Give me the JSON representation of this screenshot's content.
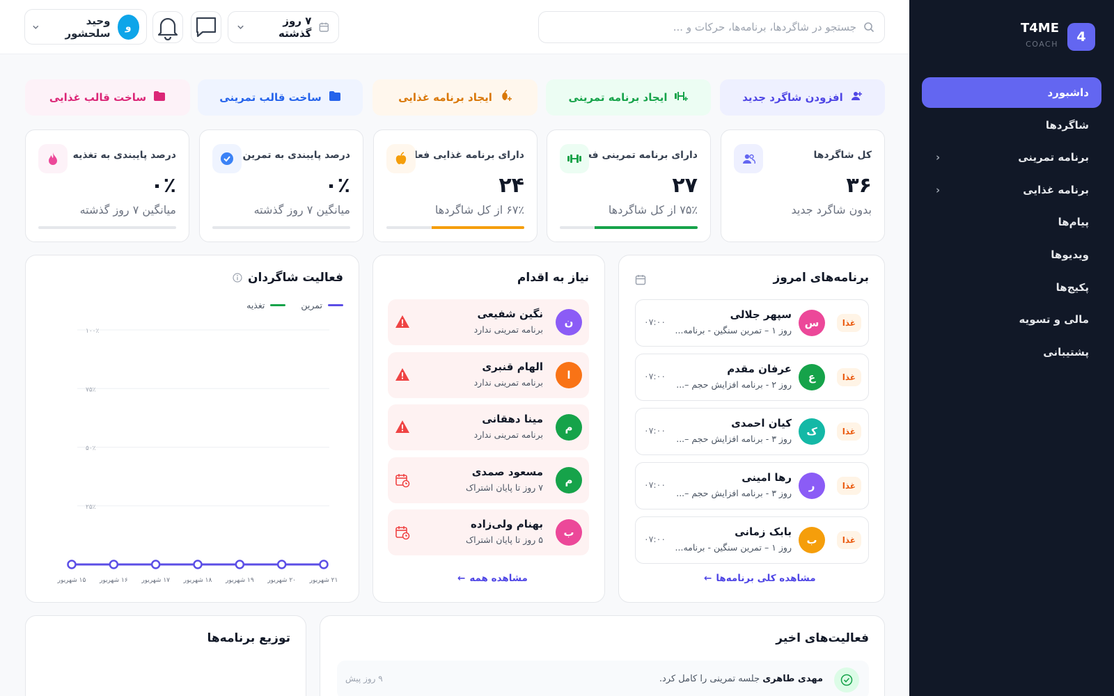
{
  "brand": {
    "badge": "4",
    "title": "T4ME",
    "subtitle": "COACH"
  },
  "nav": [
    {
      "label": "داشبورد",
      "active": true
    },
    {
      "label": "شاگردها"
    },
    {
      "label": "برنامه تمرینی",
      "chevron": true
    },
    {
      "label": "برنامه غذایی",
      "chevron": true
    },
    {
      "label": "پیام‌ها"
    },
    {
      "label": "ویدیوها"
    },
    {
      "label": "پکیج‌ها"
    },
    {
      "label": "مالی و تسویه"
    },
    {
      "label": "پشتیبانی"
    }
  ],
  "header": {
    "search_placeholder": "جستجو در شاگردها، برنامه‌ها، حرکات و ...",
    "date_range": "۷ روز گذشته",
    "user_name": "وحید سلحشور",
    "user_initial": "و"
  },
  "quick_actions": [
    {
      "label": "افزودن شاگرد جدید",
      "bg": "#eef0ff",
      "color": "#4f46e5",
      "icon": "user-plus-icon"
    },
    {
      "label": "ایجاد برنامه تمرینی",
      "bg": "#ecfdf3",
      "color": "#16a34a",
      "icon": "dumbbell-plus-icon"
    },
    {
      "label": "ایجاد برنامه غذایی",
      "bg": "#fff7ed",
      "color": "#d97706",
      "icon": "food-plus-icon"
    },
    {
      "label": "ساخت قالب تمرینی",
      "bg": "#eff4ff",
      "color": "#2563eb",
      "icon": "folder-icon"
    },
    {
      "label": "ساخت قالب غذایی",
      "bg": "#fdf2f8",
      "color": "#db2777",
      "icon": "folder-icon"
    }
  ],
  "stats": [
    {
      "title": "کل شاگردها",
      "value": "۳۶",
      "sub": "بدون شاگرد جدید",
      "icon": "users-icon",
      "icon_bg": "#eef0ff",
      "icon_color": "#6366f1",
      "bar": null
    },
    {
      "title": "دارای برنامه تمرینی فعال",
      "value": "۲۷",
      "sub": "۷۵٪ از کل شاگردها",
      "icon": "dumbbell-icon",
      "icon_bg": "#ecfdf3",
      "icon_color": "#16a34a",
      "bar": 0.75,
      "bar_color": "#16a34a"
    },
    {
      "title": "دارای برنامه غذایی فعال",
      "value": "۲۴",
      "sub": "۶۷٪ از کل شاگردها",
      "icon": "apple-icon",
      "icon_bg": "#fff7ed",
      "icon_color": "#f59e0b",
      "bar": 0.67,
      "bar_color": "#f59e0b"
    },
    {
      "title": "درصد پایبندی به تمرین",
      "value": "۰٪",
      "sub": "میانگین ۷ روز گذشته",
      "icon": "check-circle-icon",
      "icon_bg": "#eff4ff",
      "icon_color": "#3b82f6",
      "bar": 0,
      "bar_color": "#3b82f6"
    },
    {
      "title": "درصد پایبندی به تغذیه",
      "value": "۰٪",
      "sub": "میانگین ۷ روز گذشته",
      "icon": "flame-icon",
      "icon_bg": "#fdf2f8",
      "icon_color": "#ec4899",
      "bar": 0,
      "bar_color": "#ec4899"
    }
  ],
  "today": {
    "title": "برنامه‌های امروز",
    "items": [
      {
        "name": "سپهر جلالی",
        "initial": "س",
        "color": "#ec4899",
        "desc": "روز ۱ – تمرین سنگین - برنامه...",
        "time": "۰۷:۰۰",
        "tag": "غذا"
      },
      {
        "name": "عرفان مقدم",
        "initial": "ع",
        "color": "#16a34a",
        "desc": "روز ۲ - برنامه افزایش حجم –...",
        "time": "۰۷:۰۰",
        "tag": "غذا"
      },
      {
        "name": "کیان احمدی",
        "initial": "ک",
        "color": "#14b8a6",
        "desc": "روز ۳ - برنامه افزایش حجم –...",
        "time": "۰۷:۰۰",
        "tag": "غذا"
      },
      {
        "name": "رها امینی",
        "initial": "ر",
        "color": "#8b5cf6",
        "desc": "روز ۳ - برنامه افزایش حجم –...",
        "time": "۰۷:۰۰",
        "tag": "غذا"
      },
      {
        "name": "بابک زمانی",
        "initial": "ب",
        "color": "#f59e0b",
        "desc": "روز ۱ – تمرین سنگین - برنامه...",
        "time": "۰۷:۰۰",
        "tag": "غذا"
      }
    ],
    "link": "مشاهده کلی برنامه‌ها"
  },
  "actions": {
    "title": "نیاز به اقدام",
    "items": [
      {
        "name": "نگین شفیعی",
        "initial": "ن",
        "color": "#8b5cf6",
        "desc": "برنامه تمرینی ندارد",
        "icon": "warning-icon"
      },
      {
        "name": "الهام قنبری",
        "initial": "ا",
        "color": "#f97316",
        "desc": "برنامه تمرینی ندارد",
        "icon": "warning-icon"
      },
      {
        "name": "مینا دهقانی",
        "initial": "م",
        "color": "#16a34a",
        "desc": "برنامه تمرینی ندارد",
        "icon": "warning-icon"
      },
      {
        "name": "مسعود صمدی",
        "initial": "م",
        "color": "#16a34a",
        "desc": "۷ روز تا پایان اشتراک",
        "icon": "calendar-clock-icon"
      },
      {
        "name": "بهنام ولی‌زاده",
        "initial": "ب",
        "color": "#ec4899",
        "desc": "۵ روز تا پایان اشتراک",
        "icon": "calendar-clock-icon"
      }
    ],
    "link": "مشاهده همه"
  },
  "activity_chart_card": {
    "title": "فعالیت شاگردان"
  },
  "chart_data": {
    "type": "line",
    "x": [
      "۱۵ شهریور",
      "۱۶ شهریور",
      "۱۷ شهریور",
      "۱۸ شهریور",
      "۱۹ شهریور",
      "۲۰ شهریور",
      "۲۱ شهریور"
    ],
    "series": [
      {
        "name": "تمرین",
        "color": "#5b4ee6",
        "values": [
          0,
          0,
          0,
          0,
          0,
          0,
          0
        ]
      },
      {
        "name": "تغذیه",
        "color": "#16a34a",
        "values": [
          0,
          0,
          0,
          0,
          0,
          0,
          0
        ]
      }
    ],
    "yticks": [
      "۱۰۰٪",
      "۷۵٪",
      "۵۰٪",
      "۲۵٪"
    ],
    "ylim": [
      0,
      100
    ],
    "grid": true,
    "legend": "top-right"
  },
  "recent": {
    "title": "فعالیت‌های اخیر",
    "items": [
      {
        "name": "مهدی طاهری",
        "text": "جلسه تمرینی را کامل کرد.",
        "time": "۹ روز پیش"
      }
    ]
  },
  "distribution": {
    "title": "توزیع برنامه‌ها"
  }
}
